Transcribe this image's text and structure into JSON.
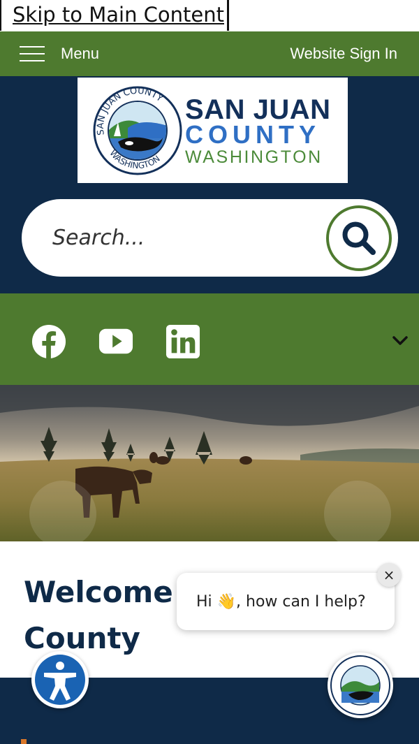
{
  "skip_link": "Skip to Main Content",
  "topbar": {
    "menu_label": "Menu",
    "signin_label": "Website Sign In"
  },
  "logo": {
    "line1": "SAN JUAN",
    "line2": "COUNTY",
    "line3": "WASHINGTON",
    "seal_top": "SAN JUAN COUNTY",
    "seal_bottom": "WASHINGTON"
  },
  "search": {
    "placeholder": "Search..."
  },
  "social": [
    "facebook-icon",
    "youtube-icon",
    "linkedin-icon"
  ],
  "welcome": {
    "heading": "Welcome to San Juan County"
  },
  "chat": {
    "message": "Hi 👋, how can I help?",
    "close": "×"
  },
  "colors": {
    "green": "#4e7a2f",
    "navy": "#0f2a48",
    "blue": "#2f6fc4",
    "accent": "#d9772a"
  }
}
